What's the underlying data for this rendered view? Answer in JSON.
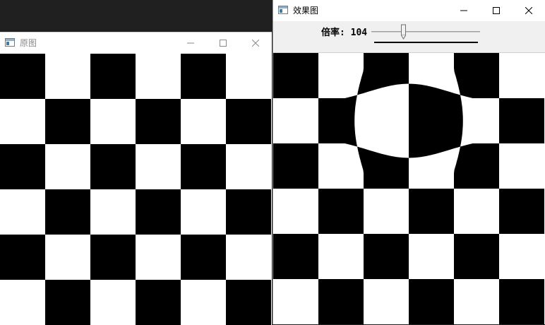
{
  "windows": {
    "original": {
      "title": "原图",
      "active": false
    },
    "effect": {
      "title": "效果图",
      "active": true
    }
  },
  "trackbar": {
    "label": "倍率: 104",
    "value": 104,
    "position_fraction": 0.29
  },
  "icons": {
    "app": "window-app-icon",
    "minimize": "minimize-icon",
    "maximize": "maximize-icon",
    "close": "close-icon"
  },
  "colors": {
    "board_dark": "#000000",
    "board_light": "#ffffff",
    "titlebar": "#ffffff",
    "panel": "#f0f0f0",
    "desktop": "#202020"
  },
  "checkerboard": {
    "cols": 6,
    "rows": 6,
    "first_cell_dark": true
  }
}
